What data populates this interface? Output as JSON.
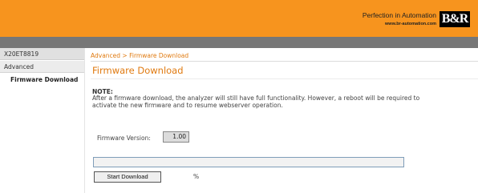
{
  "header": {
    "tagline": "Perfection in Automation",
    "url": "www.br-automation.com",
    "logo_text": "B&R",
    "background_color": "#f7941e"
  },
  "sidebar": {
    "device": "X20ET8819",
    "items": [
      {
        "label": "Advanced"
      },
      {
        "label": "Firmware Download",
        "selected": true
      }
    ]
  },
  "breadcrumb": "Advanced > Firmware Download",
  "page_title": "Firmware Download",
  "note": {
    "label": "NOTE:",
    "text": "After a firmware download, the analyzer will still have full functionality. However, a reboot will be required to activate the new firmware and to resume webserver operation."
  },
  "firmware": {
    "label": "Firmware Version:",
    "value": "1.00"
  },
  "progress": {
    "percent_value": 0,
    "percent_sign": "%"
  },
  "buttons": {
    "start_download": "Start Download"
  }
}
